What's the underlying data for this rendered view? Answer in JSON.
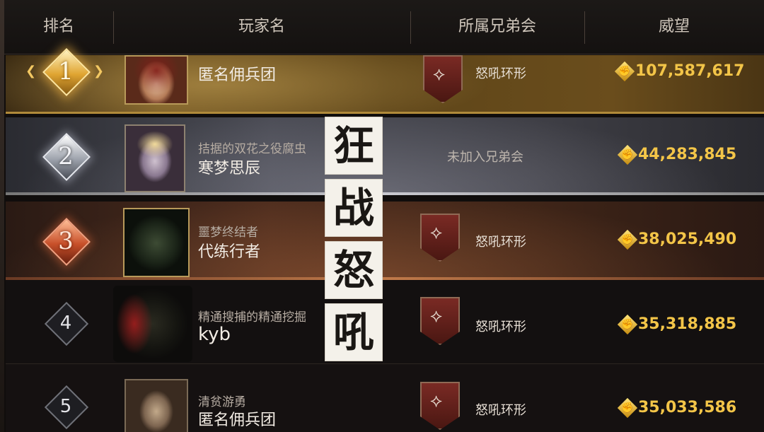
{
  "header": {
    "rank": "排名",
    "player": "玩家名",
    "clan": "所属兄弟会",
    "prestige": "威望"
  },
  "rows": [
    {
      "rank": "1",
      "title": "",
      "name": "匿名佣兵团",
      "clan": "怒吼环形",
      "prestige": "107,587,617"
    },
    {
      "rank": "2",
      "title": "拮据的双花之役腐虫",
      "name": "寒梦思辰",
      "clan": "未加入兄弟会",
      "prestige": "44,283,845"
    },
    {
      "rank": "3",
      "title": "噩梦终结者",
      "name": "代练行者",
      "clan": "怒吼环形",
      "prestige": "38,025,490"
    },
    {
      "rank": "4",
      "title": "精通搜捕的精通挖掘",
      "name": "kyb",
      "clan": "怒吼环形",
      "prestige": "35,318,885"
    },
    {
      "rank": "5",
      "title": "清贫游勇",
      "name": "匿名佣兵团",
      "clan": "怒吼环形",
      "prestige": "35,033,586"
    }
  ],
  "overlay": [
    "狂",
    "战",
    "怒",
    "吼"
  ],
  "icons": {
    "prestige": "fist-icon",
    "clan_emblem": "clan-shield-icon",
    "rank_badge": "diamond-rank-icon"
  },
  "colors": {
    "gold": "#f3c548",
    "rank1": "#e0a532",
    "rank2": "#9ea3ad",
    "rank3": "#c8502a"
  }
}
